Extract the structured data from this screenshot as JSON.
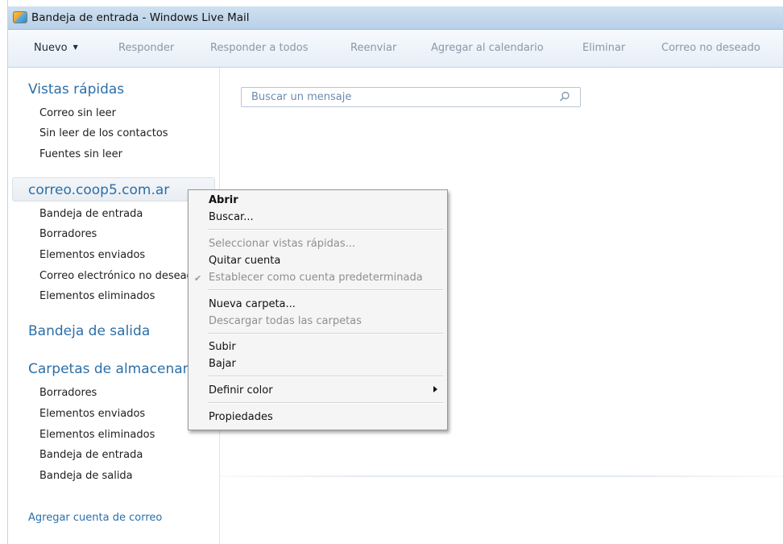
{
  "window": {
    "title": "Bandeja de entrada - Windows Live Mail"
  },
  "toolbar": {
    "items": [
      "Nuevo",
      "Responder",
      "Responder a todos",
      "Reenviar",
      "Agregar al calendario",
      "Eliminar",
      "Correo no deseado"
    ]
  },
  "sidebar": {
    "quick_views": {
      "title": "Vistas rápidas",
      "items": [
        "Correo sin leer",
        "Sin leer de los contactos",
        "Fuentes sin leer"
      ]
    },
    "account": {
      "name": "correo.coop5.com.ar",
      "folders": [
        "Bandeja de entrada",
        "Borradores",
        "Elementos enviados",
        "Correo electrónico no deseado",
        "Elementos eliminados"
      ]
    },
    "outbox": "Bandeja de salida",
    "storage": {
      "title": "Carpetas de almacenamiento",
      "items": [
        "Borradores",
        "Elementos enviados",
        "Elementos eliminados",
        "Bandeja de entrada",
        "Bandeja de salida"
      ]
    },
    "add_account": "Agregar cuenta de correo"
  },
  "search": {
    "placeholder": "Buscar un mensaje"
  },
  "context_menu": {
    "open": "Abrir",
    "find": "Buscar...",
    "select_quick_views": "Seleccionar vistas rápidas...",
    "remove_account": "Quitar cuenta",
    "set_default": "Establecer como cuenta predeterminada",
    "new_folder": "Nueva carpeta...",
    "download_all": "Descargar todas las carpetas",
    "move_up": "Subir",
    "move_down": "Bajar",
    "set_color": "Definir color",
    "properties": "Propiedades"
  },
  "colors": {
    "accent": "#2b6fa8",
    "titlebar": "#c4d8ee"
  }
}
